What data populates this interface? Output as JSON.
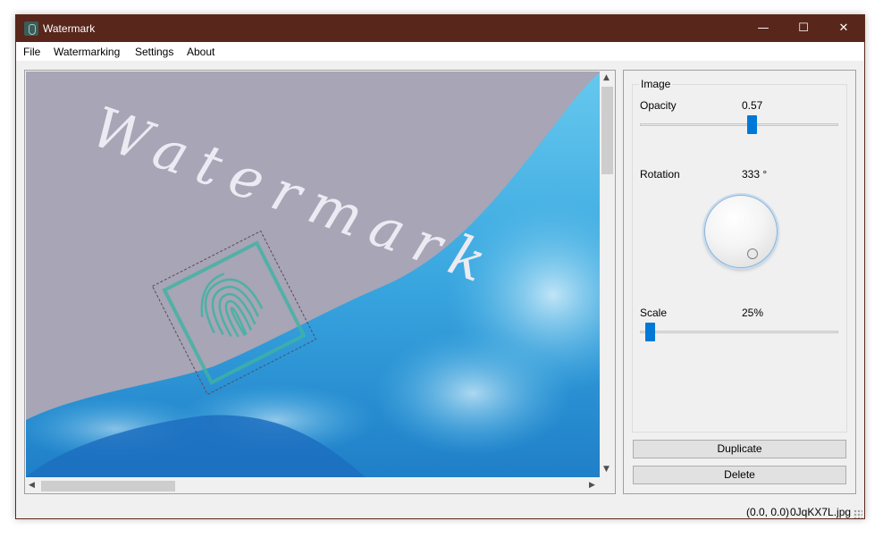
{
  "window": {
    "title": "Watermark",
    "controls": {
      "minimize": "—",
      "maximize": "☐",
      "close": "✕"
    }
  },
  "menu": [
    "File",
    "Watermarking",
    "Settings",
    "About"
  ],
  "canvas": {
    "watermark_text": "Watermark",
    "scroll_arrows": {
      "up": "▲",
      "down": "▼",
      "left": "◀",
      "right": "▶"
    }
  },
  "panel": {
    "group_title": "Image",
    "opacity": {
      "label": "Opacity",
      "value": "0.57",
      "level": 0.57
    },
    "rotation": {
      "label": "Rotation",
      "value": "333 °",
      "degrees": 333
    },
    "scale": {
      "label": "Scale",
      "value": "25%",
      "level": 0.03
    },
    "duplicate_label": "Duplicate",
    "delete_label": "Delete"
  },
  "status": {
    "coords": "(0.0, 0.0)",
    "filename": "0JqKX7L.jpg"
  },
  "colors": {
    "titlebar": "#58261a",
    "accent": "#0078d7",
    "watermark_teal": "#3fb3a3"
  }
}
